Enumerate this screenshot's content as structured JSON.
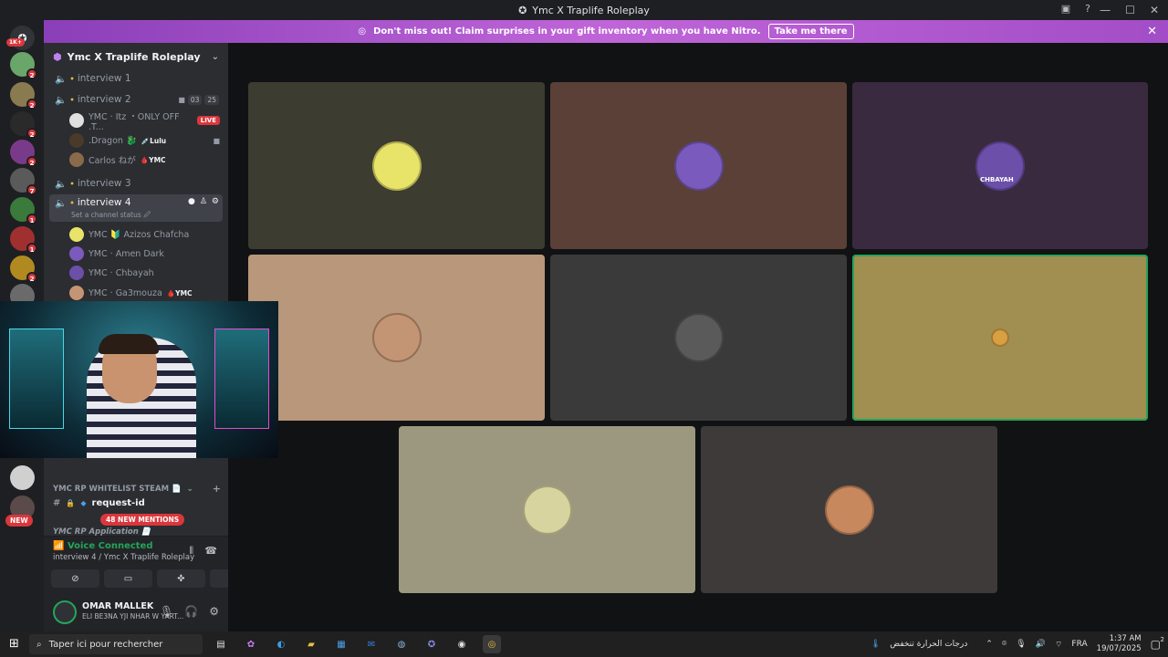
{
  "window": {
    "title": "Ymc X Traplife Roleplay"
  },
  "banner": {
    "text": "Don't miss out! Claim surprises in your gift inventory when you have Nitro.",
    "button": "Take me there"
  },
  "servers": {
    "home_badge": "1K+",
    "badges": [
      "2",
      "2",
      "2",
      "2",
      "7",
      "1",
      "1",
      "2"
    ],
    "new_label": "NEW"
  },
  "guild": {
    "name": "Ymc X Traplife Roleplay"
  },
  "channels": {
    "interview1": "interview 1",
    "interview2": "interview 2",
    "interview2_counts": [
      "03",
      "25"
    ],
    "interview2_users": [
      {
        "name": "YMC · Itz ・ONLY OFF .T...",
        "tag": "LIVE"
      },
      {
        "name": ".Dragon 🐉",
        "tag": "💉Lulu"
      },
      {
        "name": "Carlos ねが",
        "tag": "🩸YMC"
      }
    ],
    "interview3": "interview 3",
    "interview4": "interview 4",
    "interview4_status": "Set a channel status 🖉",
    "interview4_users": [
      {
        "name": "YMC 🔰 Azizos Chafcha",
        "tag": ""
      },
      {
        "name": "YMC · Amen Dark",
        "tag": ""
      },
      {
        "name": "YMC · Chbayah",
        "tag": ""
      },
      {
        "name": "YMC · Ga3mouza",
        "tag": "🩸YMC"
      }
    ],
    "whitelist_category": "YMC RP WHITELIST STEAM 📄",
    "request_channel": "request-id",
    "mentions": "48 NEW MENTIONS",
    "application_category": "YMC RP Application 📄"
  },
  "voice": {
    "status": "Voice Connected",
    "location": "interview 4 / Ymc X Traplife Roleplay"
  },
  "user": {
    "name": "OMAR MALLEK",
    "status": "ELI BE3NA YJI NHAR W YART..."
  },
  "tiles": [
    {
      "bg": "#3c3c30",
      "avatar": "#e8e46a",
      "speaking": false
    },
    {
      "bg": "#5a4036",
      "avatar": "#7a5bbd",
      "speaking": false
    },
    {
      "bg": "#3a2a40",
      "avatar": "#6b4fa8",
      "speaking": false,
      "label": "CHBAYAH"
    },
    {
      "bg": "#b8977a",
      "avatar": "#c49574",
      "speaking": false
    },
    {
      "bg": "#3a3a3a",
      "avatar": "#5a5a5a",
      "speaking": false
    },
    {
      "bg": "#a08f50",
      "avatar": "#d8a040",
      "speaking": true
    },
    {
      "bg": "#9c9880",
      "avatar": "#d8d4a0",
      "speaking": false
    },
    {
      "bg": "#3e3a3a",
      "avatar": "#c8885e",
      "speaking": false
    }
  ],
  "taskbar": {
    "search_placeholder": "Taper ici pour rechercher",
    "weather": "درجات الحرارة تنخفض",
    "lang": "FRA",
    "time": "1:37 AM",
    "date": "19/07/2025",
    "notif": "2"
  }
}
